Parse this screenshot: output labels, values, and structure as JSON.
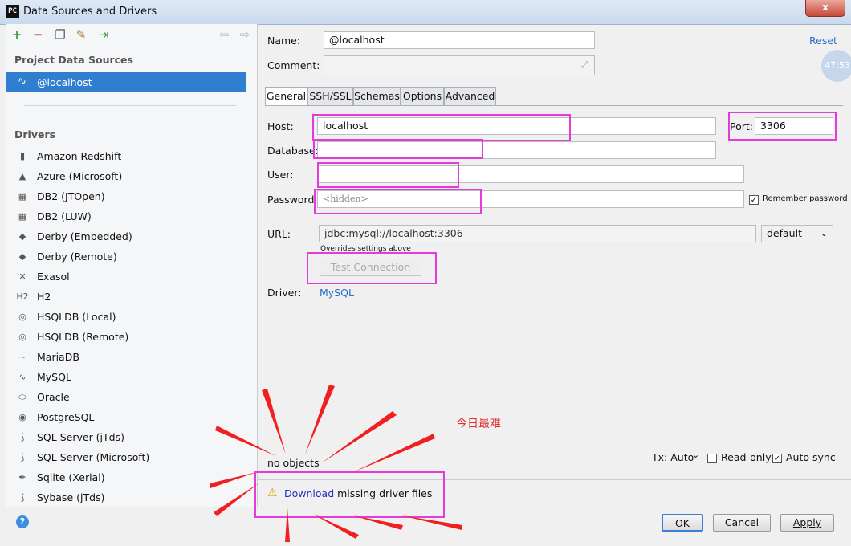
{
  "window": {
    "title": "Data Sources and Drivers",
    "app_icon": "PC",
    "close": "x"
  },
  "left": {
    "project_header": "Project Data Sources",
    "data_source": "@localhost",
    "drivers_header": "Drivers",
    "drivers": [
      {
        "label": "Amazon Redshift",
        "icon": "bars-icon",
        "glyph": "▮"
      },
      {
        "label": "Azure (Microsoft)",
        "icon": "azure-icon",
        "glyph": "▲"
      },
      {
        "label": "DB2 (JTOpen)",
        "icon": "db2-icon",
        "glyph": "▦"
      },
      {
        "label": "DB2 (LUW)",
        "icon": "db2-icon",
        "glyph": "▦"
      },
      {
        "label": "Derby (Embedded)",
        "icon": "hat-icon",
        "glyph": "◆"
      },
      {
        "label": "Derby (Remote)",
        "icon": "hat-icon",
        "glyph": "◆"
      },
      {
        "label": "Exasol",
        "icon": "x-icon",
        "glyph": "✕"
      },
      {
        "label": "H2",
        "icon": "h2-icon",
        "glyph": "H2"
      },
      {
        "label": "HSQLDB (Local)",
        "icon": "hsqldb-icon",
        "glyph": "◎"
      },
      {
        "label": "HSQLDB (Remote)",
        "icon": "hsqldb-icon",
        "glyph": "◎"
      },
      {
        "label": "MariaDB",
        "icon": "seal-icon",
        "glyph": "~"
      },
      {
        "label": "MySQL",
        "icon": "dolphin-icon",
        "glyph": "∿"
      },
      {
        "label": "Oracle",
        "icon": "oracle-icon",
        "glyph": "⬭"
      },
      {
        "label": "PostgreSQL",
        "icon": "elephant-icon",
        "glyph": "◉"
      },
      {
        "label": "SQL Server (jTds)",
        "icon": "sqlserver-icon",
        "glyph": "⟆"
      },
      {
        "label": "SQL Server (Microsoft)",
        "icon": "sqlserver-icon",
        "glyph": "⟆"
      },
      {
        "label": "Sqlite (Xerial)",
        "icon": "feather-icon",
        "glyph": "✒"
      },
      {
        "label": "Sybase (jTds)",
        "icon": "sybase-icon",
        "glyph": "⟆"
      }
    ]
  },
  "form": {
    "name_label": "Name:",
    "name_value": "@localhost",
    "reset": "Reset",
    "comment_label": "Comment:",
    "tabs": [
      "General",
      "SSH/SSL",
      "Schemas",
      "Options",
      "Advanced"
    ],
    "host_label": "Host:",
    "host_value": "localhost",
    "port_label": "Port:",
    "port_value": "3306",
    "database_label": "Database:",
    "user_label": "User:",
    "password_label": "Password:",
    "password_placeholder": "<hidden>",
    "remember_password": "Remember password",
    "url_label": "URL:",
    "url_value": "jdbc:mysql://localhost:3306",
    "url_mode": "default",
    "url_hint": "Overrides settings above",
    "test_connection": "Test Connection",
    "driver_label": "Driver:",
    "driver_value": "MySQL"
  },
  "footer": {
    "annotation": "今日最难",
    "no_objects": "no objects",
    "tx": "Tx: Auto",
    "read_only": "Read-only",
    "auto_sync": "Auto sync",
    "download_link": "Download",
    "download_rest": " missing driver files",
    "ok": "OK",
    "cancel": "Cancel",
    "apply": "Apply"
  },
  "clock": "47:53",
  "colors": {
    "selection": "#2f7ecf",
    "highlight": "#e53bd9",
    "arrow": "#f02020",
    "link": "#2a6fc4"
  }
}
